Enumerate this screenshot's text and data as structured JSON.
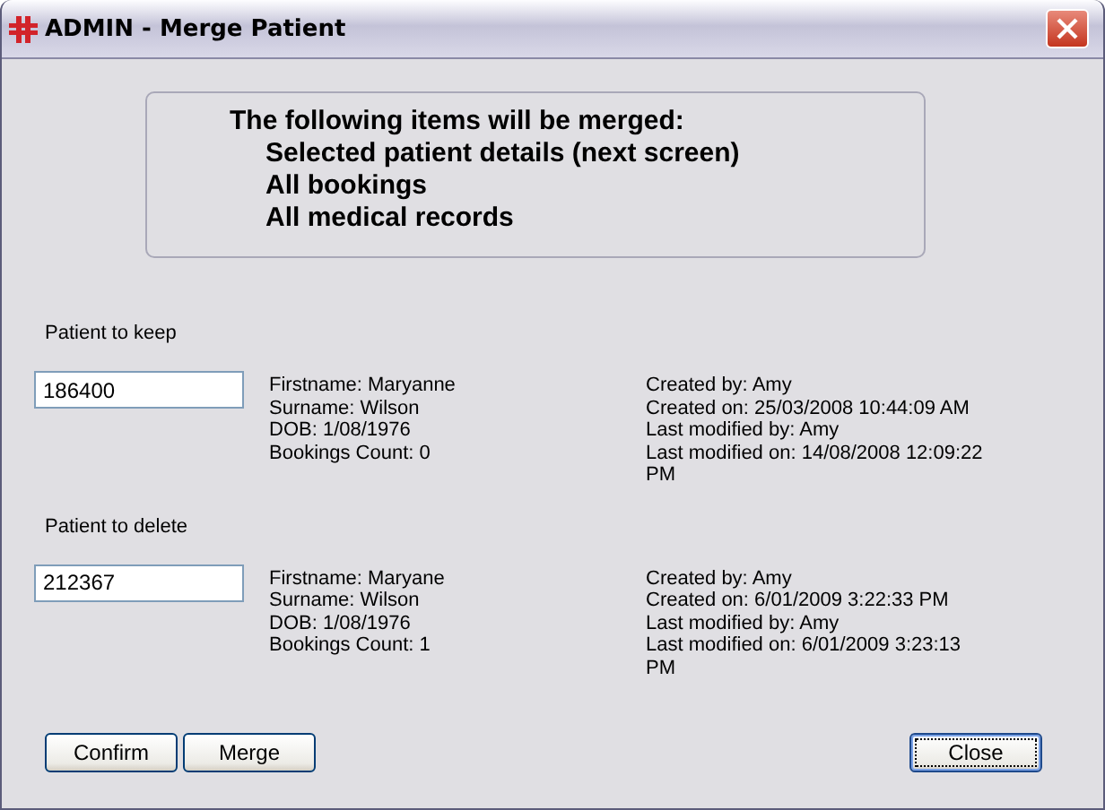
{
  "window": {
    "title": "ADMIN - Merge Patient"
  },
  "info": {
    "heading": "The following items will be merged:",
    "items": [
      "Selected patient details (next screen)",
      "All bookings",
      "All medical records"
    ]
  },
  "patients": [
    {
      "label": "Patient to keep",
      "id": "186400",
      "details": [
        "Firstname: Maryanne",
        "Surname: Wilson",
        "DOB: 1/08/1976",
        "Bookings Count: 0"
      ],
      "audit": [
        "Created by: Amy",
        "Created on: 25/03/2008 10:44:09 AM",
        "Last modified by: Amy",
        "Last modified on: 14/08/2008 12:09:22 PM"
      ]
    },
    {
      "label": "Patient to delete",
      "id": "212367",
      "details": [
        "Firstname: Maryane",
        "Surname: Wilson",
        "DOB: 1/08/1976",
        "Bookings Count: 1"
      ],
      "audit": [
        "Created by: Amy",
        "Created on: 6/01/2009 3:22:33 PM",
        "Last modified by: Amy",
        "Last modified on: 6/01/2009 3:23:13 PM"
      ]
    }
  ],
  "buttons": [
    {
      "label": "Confirm",
      "focused": false
    },
    {
      "label": "Merge",
      "focused": false
    },
    {
      "label": "Close",
      "focused": true
    }
  ]
}
